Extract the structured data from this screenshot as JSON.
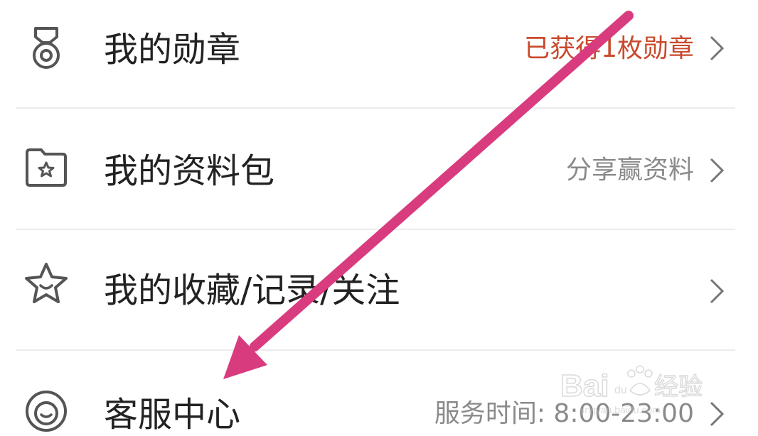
{
  "menu": {
    "items": [
      {
        "icon": "medal-icon",
        "label": "我的勋章",
        "detail": "已获得1枚勋章",
        "detail_color": "#c94a2c"
      },
      {
        "icon": "folder-star-icon",
        "label": "我的资料包",
        "detail": "分享赢资料",
        "detail_color": "#8a8a8a"
      },
      {
        "icon": "star-smile-icon",
        "label": "我的收藏/记录/关注",
        "detail": "",
        "detail_color": "#8a8a8a"
      },
      {
        "icon": "headset-icon",
        "label": "客服中心",
        "detail": "服务时间: 8:00-23:00",
        "detail_color": "#8a8a8a"
      }
    ]
  },
  "annotation": {
    "arrow_color": "#d93b7f"
  },
  "watermark": {
    "brand": "Baidu经验",
    "url": "jingyan.baidu.com"
  }
}
